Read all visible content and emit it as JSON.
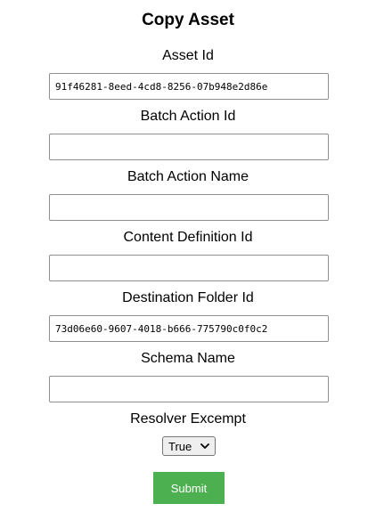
{
  "form": {
    "title": "Copy Asset",
    "fields": [
      {
        "label": "Asset Id",
        "value": "91f46281-8eed-4cd8-8256-07b948e2d86e",
        "placeholder": ""
      },
      {
        "label": "Batch Action Id",
        "value": "",
        "placeholder": ""
      },
      {
        "label": "Batch Action Name",
        "value": "",
        "placeholder": ""
      },
      {
        "label": "Content Definition Id",
        "value": "",
        "placeholder": ""
      },
      {
        "label": "Destination Folder Id",
        "value": "73d06e60-9607-4018-b666-775790c0f0c2",
        "placeholder": ""
      },
      {
        "label": "Schema Name",
        "value": "",
        "placeholder": ""
      }
    ],
    "resolver": {
      "label": "Resolver Excempt",
      "selected": "True"
    },
    "submit_label": "Submit"
  },
  "colors": {
    "submit_bg": "#4caf50",
    "submit_text": "#ffffff"
  },
  "icons": {
    "select_arrow": "chevron-down-icon"
  }
}
